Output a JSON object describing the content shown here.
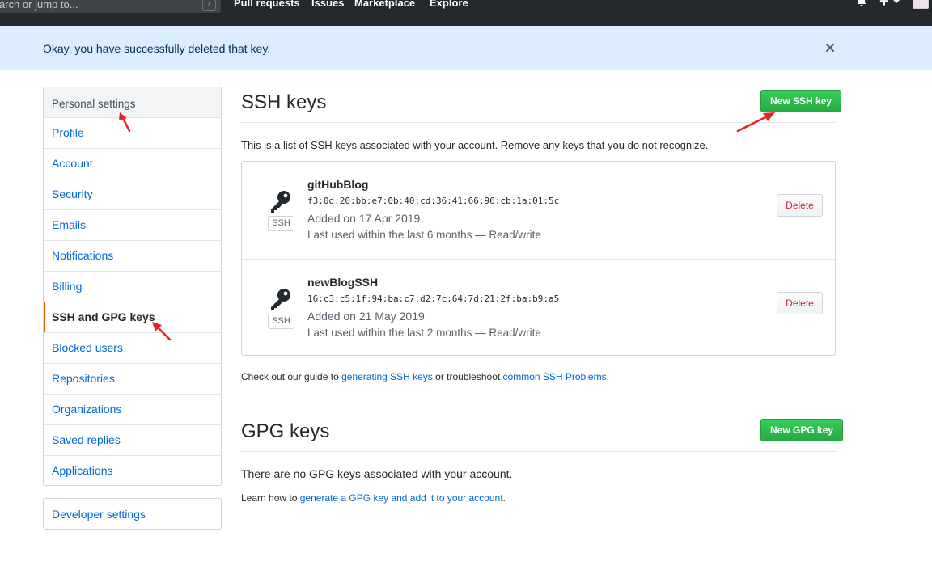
{
  "header": {
    "search_placeholder": "arch or jump to...",
    "search_key_hint": "/",
    "nav": [
      "Pull requests",
      "Issues",
      "Marketplace",
      "Explore"
    ]
  },
  "flash": {
    "message": "Okay, you have successfully deleted that key."
  },
  "sidebar": {
    "heading": "Personal settings",
    "items": [
      {
        "label": "Profile"
      },
      {
        "label": "Account"
      },
      {
        "label": "Security"
      },
      {
        "label": "Emails"
      },
      {
        "label": "Notifications"
      },
      {
        "label": "Billing"
      },
      {
        "label": "SSH and GPG keys",
        "selected": true
      },
      {
        "label": "Blocked users"
      },
      {
        "label": "Repositories"
      },
      {
        "label": "Organizations"
      },
      {
        "label": "Saved replies"
      },
      {
        "label": "Applications"
      }
    ],
    "developer_settings": "Developer settings"
  },
  "ssh": {
    "title": "SSH keys",
    "new_button": "New SSH key",
    "description": "This is a list of SSH keys associated with your account. Remove any keys that you do not recognize.",
    "keys": [
      {
        "title": "gitHubBlog",
        "fingerprint": "f3:0d:20:bb:e7:0b:40:cd:36:41:66:96:cb:1a:01:5c",
        "added": "Added on 17 Apr 2019",
        "last_used": "Last used within the last 6 months — Read/write",
        "type_label": "SSH",
        "delete_label": "Delete"
      },
      {
        "title": "newBlogSSH",
        "fingerprint": "16:c3:c5:1f:94:ba:c7:d2:7c:64:7d:21:2f:ba:b9:a5",
        "added": "Added on 21 May 2019",
        "last_used": "Last used within the last 2 months — Read/write",
        "type_label": "SSH",
        "delete_label": "Delete"
      }
    ],
    "guide_prefix": "Check out our guide to ",
    "guide_link": "generating SSH keys",
    "guide_middle": " or troubleshoot ",
    "guide_link2": "common SSH Problems",
    "guide_suffix": "."
  },
  "gpg": {
    "title": "GPG keys",
    "new_button": "New GPG key",
    "empty": "There are no GPG keys associated with your account.",
    "learn_prefix": "Learn how to ",
    "learn_link": "generate a GPG key and add it to your account",
    "learn_suffix": "."
  },
  "colors": {
    "header_bg": "#24292e",
    "flash_bg": "#dbedff",
    "link": "#0366d6",
    "primary_green": "#28a745",
    "danger": "#cb2431",
    "selected_marker": "#e36209",
    "annotation_arrow": "#e8202a"
  }
}
